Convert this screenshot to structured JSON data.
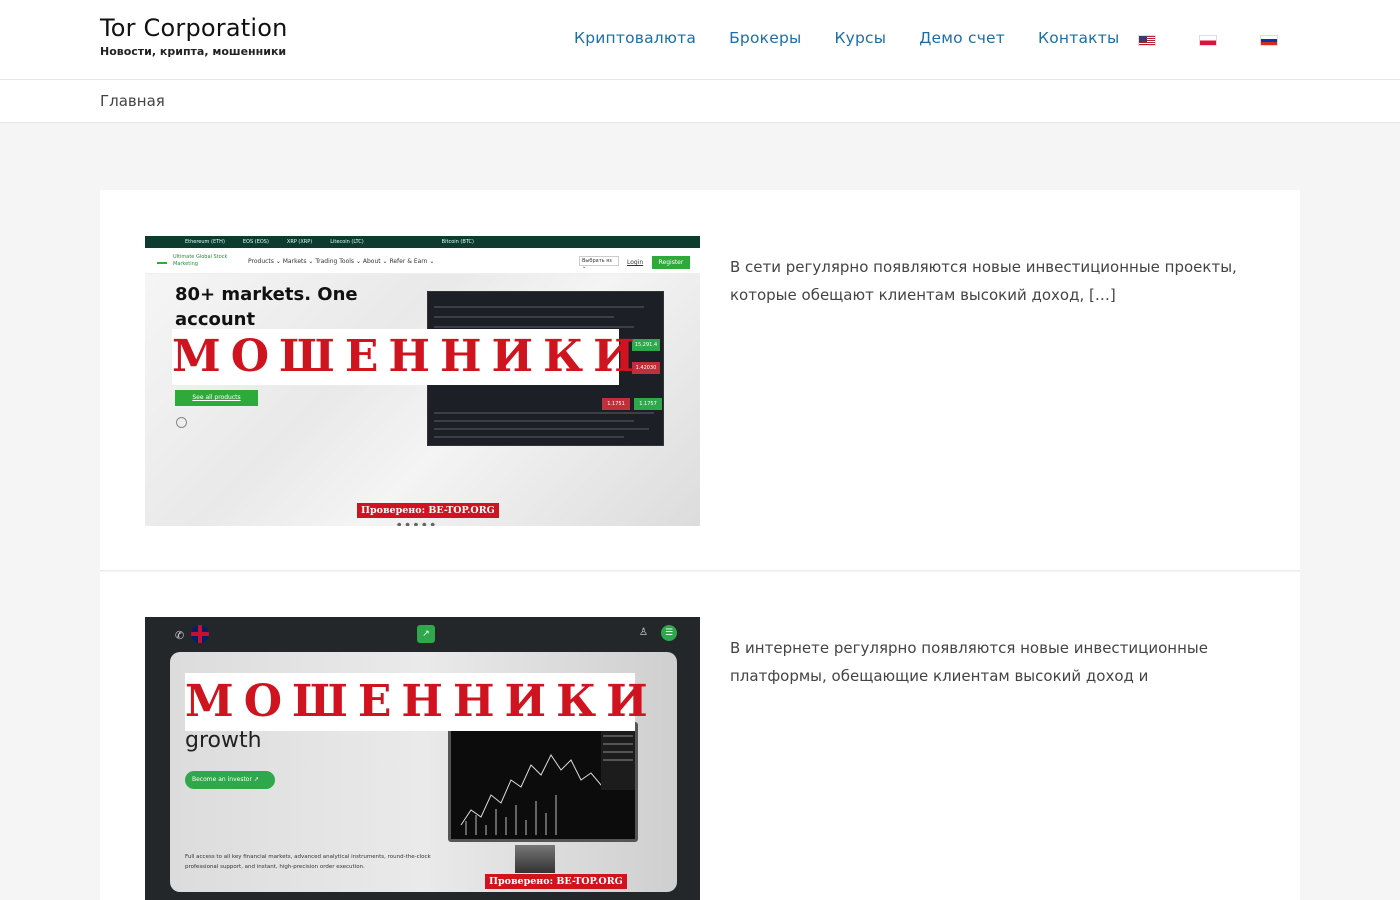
{
  "header": {
    "site_title": "Tor Corporation",
    "tagline": "Новости, крипта, мошенники",
    "nav": [
      "Криптовалюта",
      "Брокеры",
      "Курсы",
      "Демо счет",
      "Контакты"
    ],
    "flags": [
      "us-flag",
      "pl-flag",
      "ru-flag"
    ]
  },
  "breadcrumb": {
    "home": "Главная"
  },
  "posts": [
    {
      "excerpt": "В сети регулярно появляются новые инвестиционные проекты, которые обещают клиентам высокий доход, […]",
      "thumb": {
        "ticker": [
          "Ethereum (ETH)",
          "EOS (EOS)",
          "XRP (XRP)",
          "Litecoin (LTC)",
          "Bitcoin (BTC)"
        ],
        "logo": "Ultimate Global Stock Marketing",
        "menu": "Products ⌄   Markets ⌄   Trading Tools ⌄   About ⌄   Refer & Earn ⌄",
        "select": "Выбрать яз ⌄",
        "login": "Login",
        "signup": "Register",
        "headline": "80+ markets. One account",
        "cta": "See all products",
        "stamp": "МОШЕННИКИ",
        "verified": "Проверено: BE-TOP.ORG",
        "price_tags": [
          "15,291.4",
          "1.42030",
          "1.1751",
          "1.1757"
        ]
      }
    },
    {
      "excerpt": "В интернете регулярно появляются новые инвестиционные платформы, обещающие клиентам высокий доход и",
      "thumb": {
        "heading": "growth",
        "cta": "Become an investor",
        "cta_arrow": "↗",
        "fine_print": "Full access to all key financial markets, advanced analytical instruments, round-the-clock professional support, and instant, high-precision order execution.",
        "stamp": "МОШЕННИКИ",
        "verified": "Проверено: BE-TOP.ORG",
        "phone_icon": "✆",
        "user_icon": "♙",
        "menu_icon": "☰",
        "logo_icon": "↗"
      }
    }
  ],
  "colors": {
    "link": "#1a6fa8",
    "stamp_red": "#d0141f",
    "brand_green": "#2eaa3a"
  }
}
